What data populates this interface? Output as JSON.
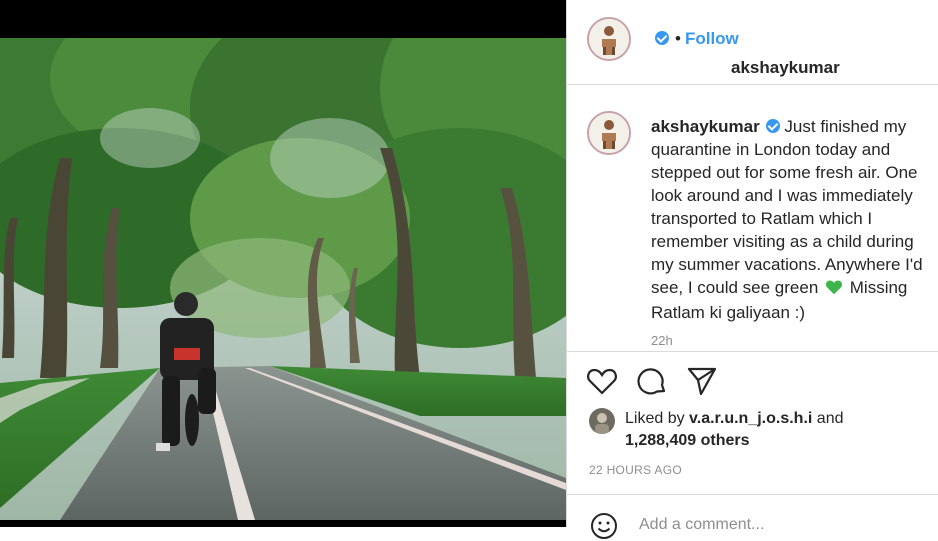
{
  "post": {
    "username": "akshaykumar",
    "follow_separator": "•",
    "follow_label": "Follow",
    "caption_text": "Just finished my quarantine in London today and stepped out for some fresh air. One look around and I was immediately transported to Ratlam which I remember visiting as a child during my summer vacations. Anywhere I'd see, I could see green",
    "caption_tail": "Missing Ratlam ki galiyaan :)",
    "caption_emoji": "green-heart-icon",
    "timestamp": "22h"
  },
  "actions": {
    "like_icon": "heart-outline-icon",
    "comment_icon": "comment-bubble-icon",
    "share_icon": "paper-plane-icon"
  },
  "likes": {
    "liked_by_prefix": "Liked by",
    "liked_by_user": "v.a.r.u.n_j.o.s.h.i",
    "and_word": "and",
    "others_count": "1,288,409 others"
  },
  "posted_ago": "22 HOURS AGO",
  "comment": {
    "placeholder": "Add a comment...",
    "emoji_icon": "smiley-icon"
  },
  "colors": {
    "accent_blue": "#3897f0",
    "green_heart": "#3cb54a",
    "muted_text": "#8e8e8e",
    "divider": "#dbdbdb"
  }
}
